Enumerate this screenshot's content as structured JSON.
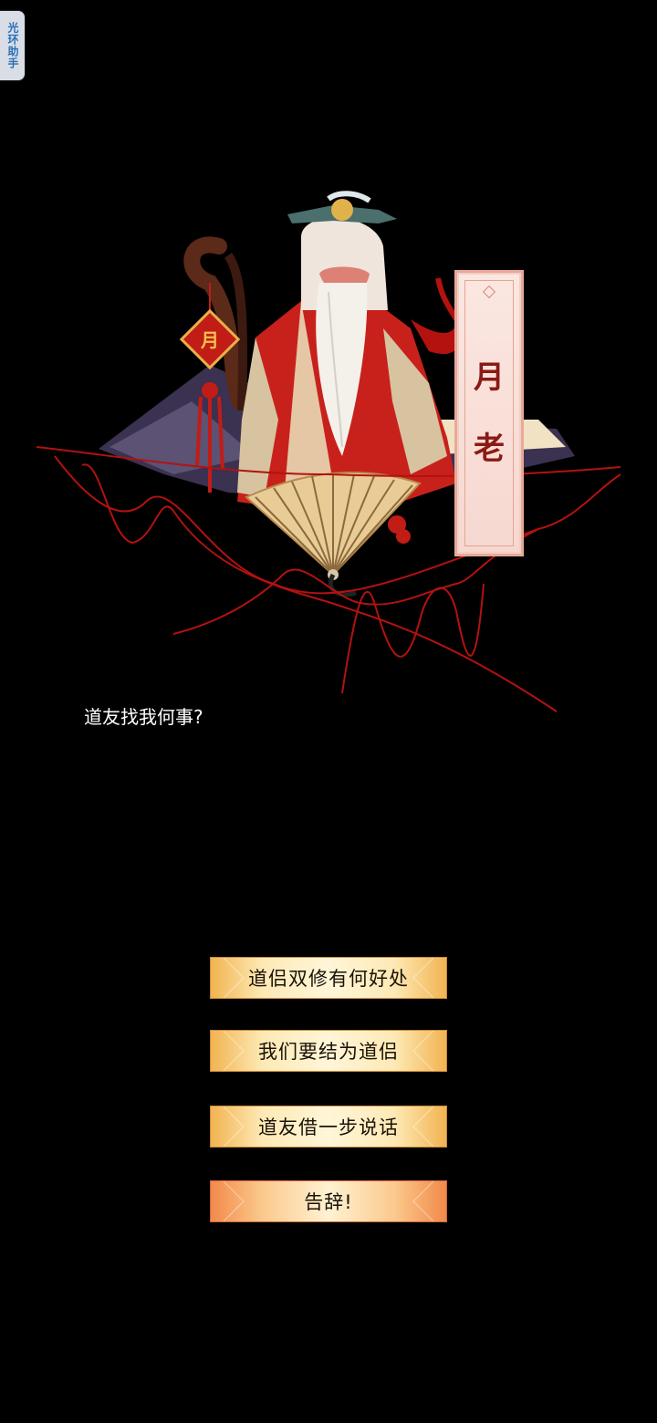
{
  "helper": {
    "label": "光环助手"
  },
  "npc": {
    "name_chars": [
      "月",
      "老"
    ],
    "dialog": "道友找我何事?"
  },
  "options": [
    {
      "label": "道侣双修有何好处"
    },
    {
      "label": "我们要结为道侣"
    },
    {
      "label": "道友借一步说话"
    },
    {
      "label": "告辞!"
    }
  ],
  "colors": {
    "background": "#000000",
    "button_gold": "#f2b451",
    "button_leave": "#f28a4a",
    "name_text": "#8a1a14",
    "red_thread": "#b3120f"
  }
}
